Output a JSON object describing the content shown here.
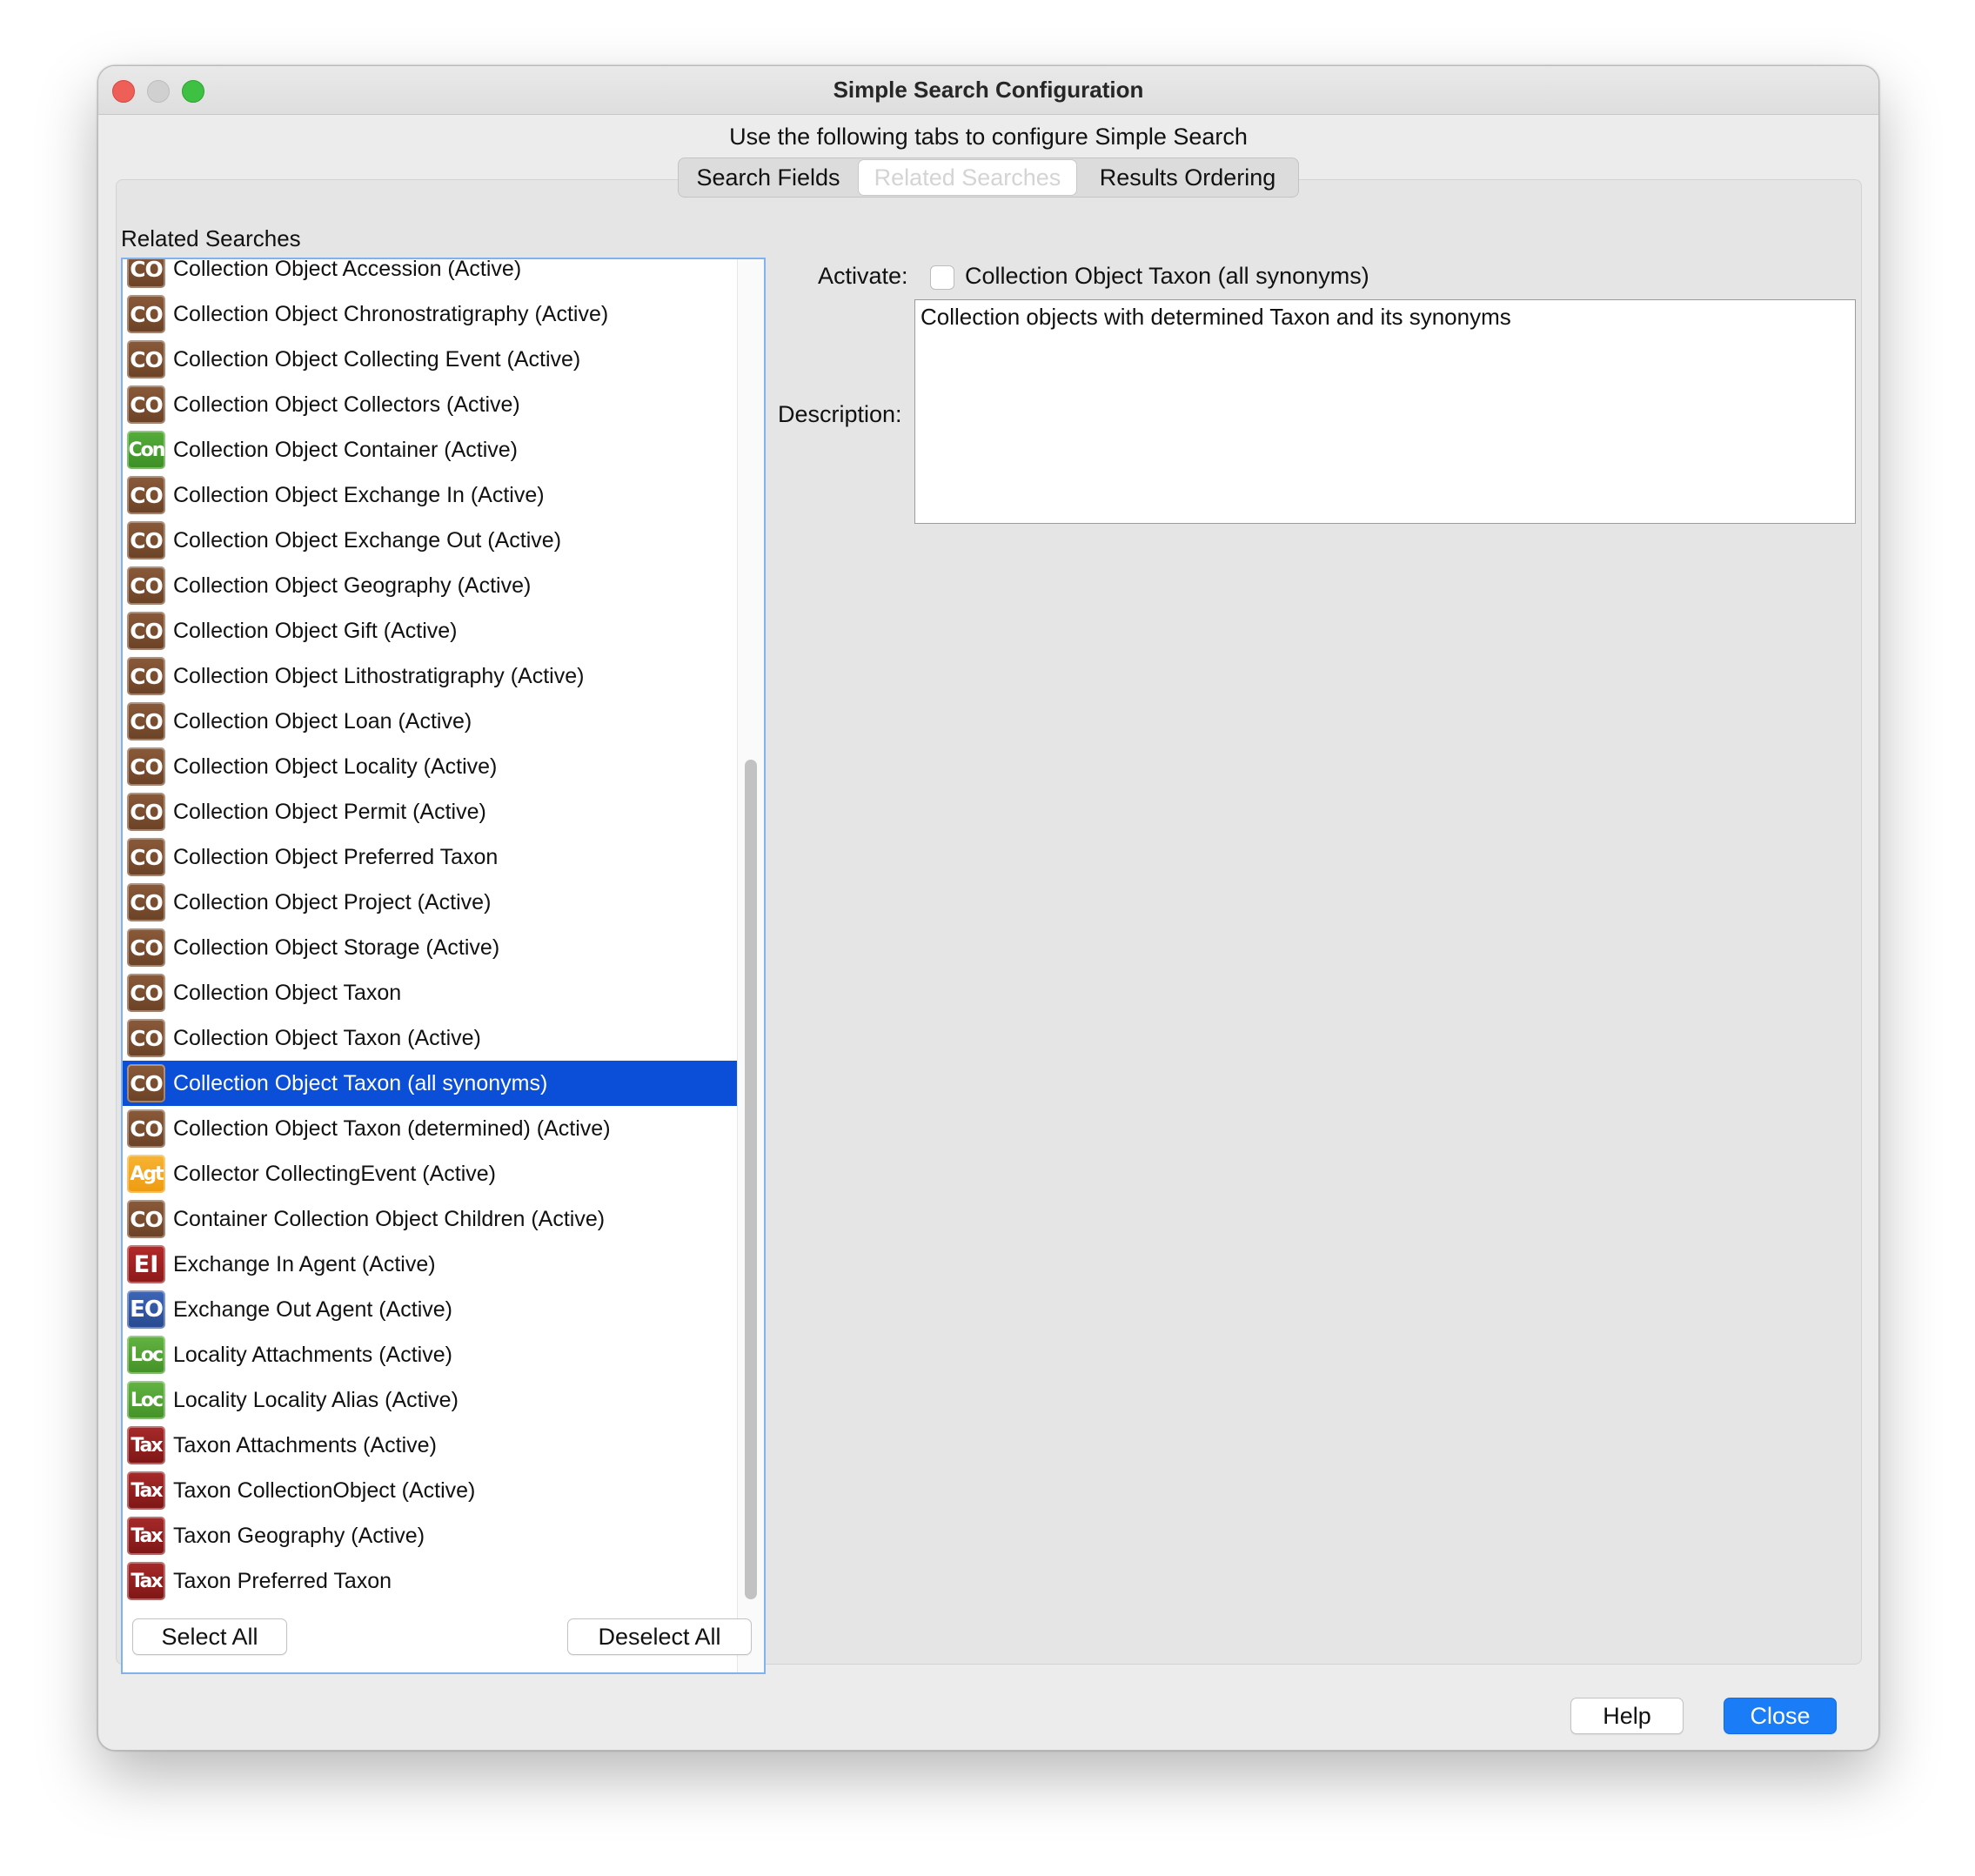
{
  "window": {
    "title": "Simple Search Configuration"
  },
  "subtitle": "Use the following tabs to configure Simple Search",
  "tabs": [
    {
      "label": "Search Fields"
    },
    {
      "label": "Related Searches"
    },
    {
      "label": "Results Ordering"
    }
  ],
  "related_searches": {
    "heading": "Related Searches",
    "items": [
      {
        "icon": "CO",
        "label": "Collection Object Accession (Active)"
      },
      {
        "icon": "CO",
        "label": "Collection Object Chronostratigraphy (Active)"
      },
      {
        "icon": "CO",
        "label": "Collection Object Collecting Event (Active)"
      },
      {
        "icon": "CO",
        "label": "Collection Object Collectors (Active)"
      },
      {
        "icon": "Con",
        "label": "Collection Object Container (Active)"
      },
      {
        "icon": "CO",
        "label": "Collection Object Exchange In (Active)"
      },
      {
        "icon": "CO",
        "label": "Collection Object Exchange Out (Active)"
      },
      {
        "icon": "CO",
        "label": "Collection Object Geography (Active)"
      },
      {
        "icon": "CO",
        "label": "Collection Object Gift (Active)"
      },
      {
        "icon": "CO",
        "label": "Collection Object Lithostratigraphy (Active)"
      },
      {
        "icon": "CO",
        "label": "Collection Object Loan (Active)"
      },
      {
        "icon": "CO",
        "label": "Collection Object Locality (Active)"
      },
      {
        "icon": "CO",
        "label": "Collection Object Permit (Active)"
      },
      {
        "icon": "CO",
        "label": "Collection Object Preferred Taxon"
      },
      {
        "icon": "CO",
        "label": "Collection Object Project (Active)"
      },
      {
        "icon": "CO",
        "label": "Collection Object Storage (Active)"
      },
      {
        "icon": "CO",
        "label": "Collection Object Taxon"
      },
      {
        "icon": "CO",
        "label": "Collection Object Taxon (Active)"
      },
      {
        "icon": "CO",
        "label": "Collection Object Taxon (all synonyms)"
      },
      {
        "icon": "CO",
        "label": "Collection Object Taxon (determined) (Active)"
      },
      {
        "icon": "Agt",
        "label": "Collector CollectingEvent (Active)"
      },
      {
        "icon": "CO",
        "label": "Container Collection Object Children (Active)"
      },
      {
        "icon": "EI",
        "label": "Exchange In Agent (Active)"
      },
      {
        "icon": "EO",
        "label": "Exchange Out Agent (Active)"
      },
      {
        "icon": "Loc",
        "label": "Locality Attachments (Active)"
      },
      {
        "icon": "Loc",
        "label": "Locality Locality Alias (Active)"
      },
      {
        "icon": "Tax",
        "label": "Taxon Attachments (Active)"
      },
      {
        "icon": "Tax",
        "label": "Taxon CollectionObject (Active)"
      },
      {
        "icon": "Tax",
        "label": "Taxon Geography (Active)"
      },
      {
        "icon": "Tax",
        "label": "Taxon Preferred Taxon"
      }
    ],
    "selected_label": "Collection Object Taxon (all synonyms)",
    "select_all_label": "Select All",
    "deselect_all_label": "Deselect All"
  },
  "detail": {
    "activate_label": "Activate:",
    "activate_checked": false,
    "name": "Collection Object Taxon (all synonyms)",
    "description_label": "Description:",
    "description": "Collection objects with determined Taxon and its synonyms"
  },
  "footer": {
    "help_label": "Help",
    "close_label": "Close"
  },
  "colors": {
    "selection": "#0b4ed8",
    "accent_button": "#1a7cf6",
    "list_focus_border": "#7fb2ee"
  }
}
